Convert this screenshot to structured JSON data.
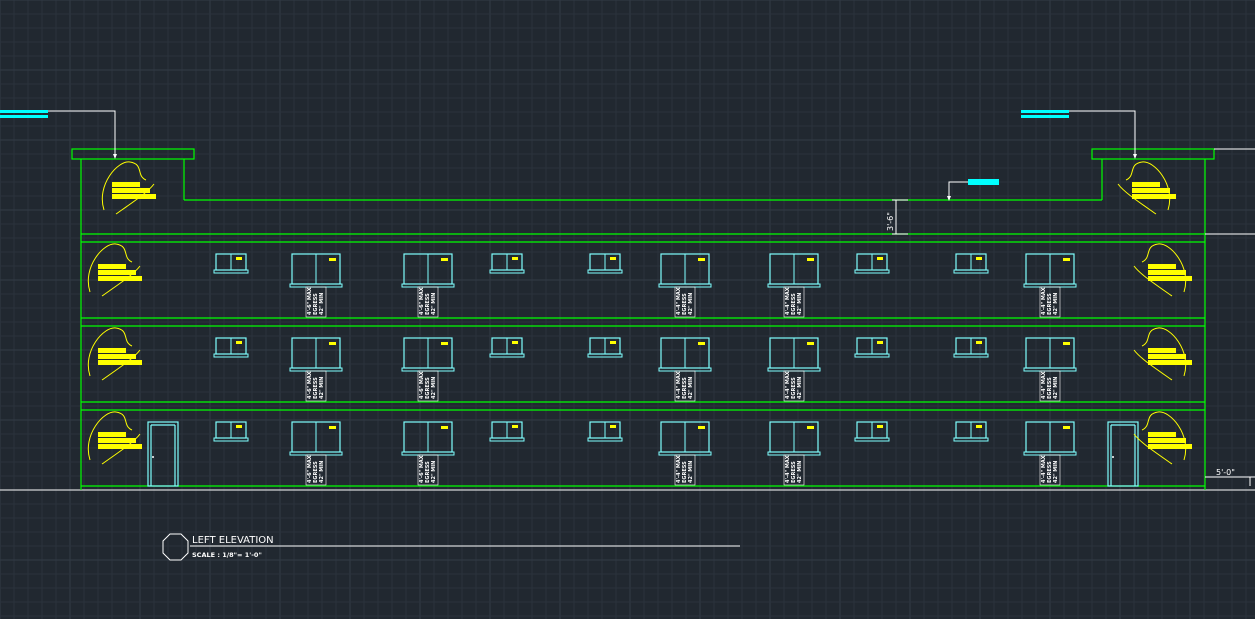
{
  "drawing": {
    "title": "LEFT ELEVATION",
    "scale": "SCALE : 1/8\"= 1'-0\"",
    "dimension_parapet": "3'-6\"",
    "dimension_right": "5'-0\"",
    "egress_note_lines": [
      "4'-6\" MAX",
      "EGRESS",
      "42\" MIN"
    ],
    "egress_note_lines_alt": [
      "4'-4\" MAX",
      "EGRESS",
      "42\" MIN"
    ]
  },
  "colors": {
    "background": "#212830",
    "grid_minor": "#2a323c",
    "grid_major": "#323b46",
    "walls": "#00ff00",
    "windows": "#7fffff",
    "cyan_tag": "#00ffff",
    "yellow": "#ffff00",
    "leader": "#ffffff"
  },
  "icons": {
    "title_marker": "octagon-icon",
    "tree_symbol": "tree-elevation-icon"
  }
}
